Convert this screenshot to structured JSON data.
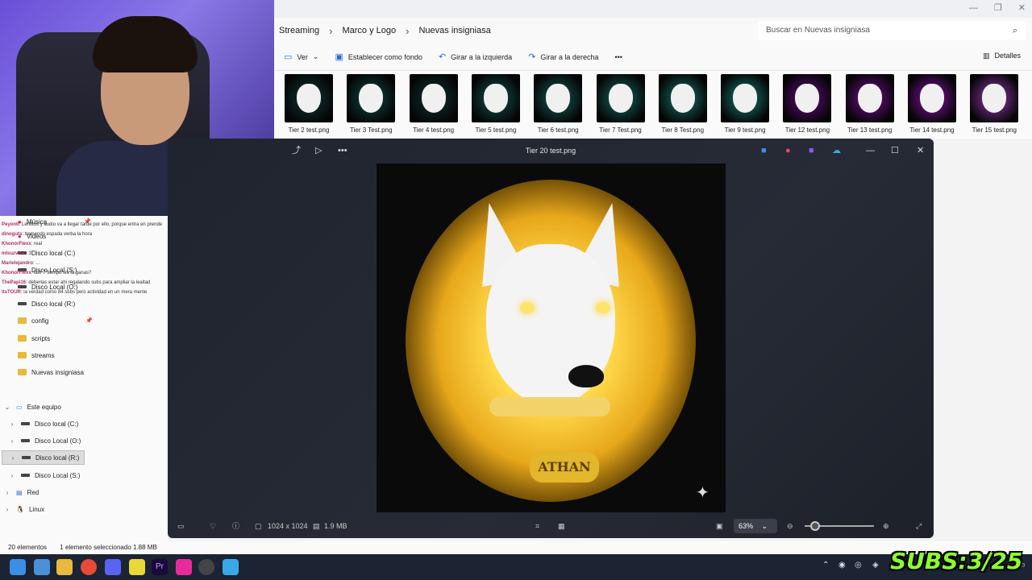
{
  "breadcrumb": [
    "Streaming",
    "Marco y Logo",
    "Nuevas insigniasa"
  ],
  "search": {
    "placeholder": "Buscar en Nuevas insigniasa"
  },
  "toolbar": {
    "view": "Ver",
    "set_background": "Establecer como fondo",
    "rotate_left": "Girar a la izquierda",
    "rotate_right": "Girar a la derecha",
    "more": "•••",
    "details": "Detalles"
  },
  "thumbnails": [
    {
      "label": "Tier 2  test.png",
      "color": "#0f3a3a"
    },
    {
      "label": "Tier 3 Test.png",
      "color": "#0f4a48"
    },
    {
      "label": "Tier 4 test.png",
      "color": "#0e3535"
    },
    {
      "label": "Tier 5 test.png",
      "color": "#105552"
    },
    {
      "label": "Tier 6 test.png",
      "color": "#13605c"
    },
    {
      "label": "Tier 7 Test.png",
      "color": "#156a64"
    },
    {
      "label": "Tier 8 Test.png",
      "color": "#17746c"
    },
    {
      "label": "Tier 9 test.png",
      "color": "#1a7e74"
    },
    {
      "label": "Tier 12 test.png",
      "color": "#6a0a8a"
    },
    {
      "label": "Tier 13 test.png",
      "color": "#7a0e9a"
    },
    {
      "label": "Tier 14 test.png",
      "color": "#8a12aa"
    },
    {
      "label": "Tier 15 test.png",
      "color": "#9a3ab8"
    }
  ],
  "nav": {
    "musica": "Música",
    "videos": "Videos",
    "disco_c_top": "Disco local (C:)",
    "disco_s_top": "Disco Local (S:)",
    "disco_o_top": "Disco Local (O:)",
    "disco_r_top": "Disco local (R:)",
    "config": "config",
    "scripts": "scripts",
    "streams": "streams",
    "nuevas": "Nuevas insigniasa",
    "este_equipo": "Este equipo",
    "disco_c": "Disco local (C:)",
    "disco_o": "Disco Local (O:)",
    "disco_r": "Disco local (R:)",
    "disco_s": "Disco Local (S:)",
    "red": "Red",
    "linux": "Linux"
  },
  "chat": [
    {
      "user": "Peyonti",
      "text": ": Lentitos y audio va a llegar tarde por ello, porque entra en prende"
    },
    {
      "user": "dinoguts",
      "text": ": tremendo espada verba la hora"
    },
    {
      "user": "KhonorFlexx",
      "text": ": real"
    },
    {
      "user": "mlsuzvick",
      "text": ": :3"
    },
    {
      "user": "Marielejandro",
      "text": ": ..."
    },
    {
      "user": "KhonorFlexx",
      "text": ": lasr 7 tiempo sin la ganas?"
    },
    {
      "user": "ThePapi16",
      "text": ": deberias estar ahi regalando subs para ampliar la lealtad"
    },
    {
      "user": "itsTOUR",
      "text": ": la verdad como 84 subs pero actividad en un mera mente"
    }
  ],
  "viewer": {
    "title": "Tier 20 test.png",
    "dimensions": "1024 x 1024",
    "size": "1.9 MB",
    "zoom": "63%",
    "tag_text": "ATHAN"
  },
  "status": {
    "count": "20 elementos",
    "selected": "1 elemento seleccionado  1.88 MB"
  },
  "overlay": {
    "subs": "SUBS:3/25"
  },
  "colors": {
    "accent": "#2a6ad4",
    "subs_green": "#8bff2e",
    "glow": "#ffd84a"
  }
}
